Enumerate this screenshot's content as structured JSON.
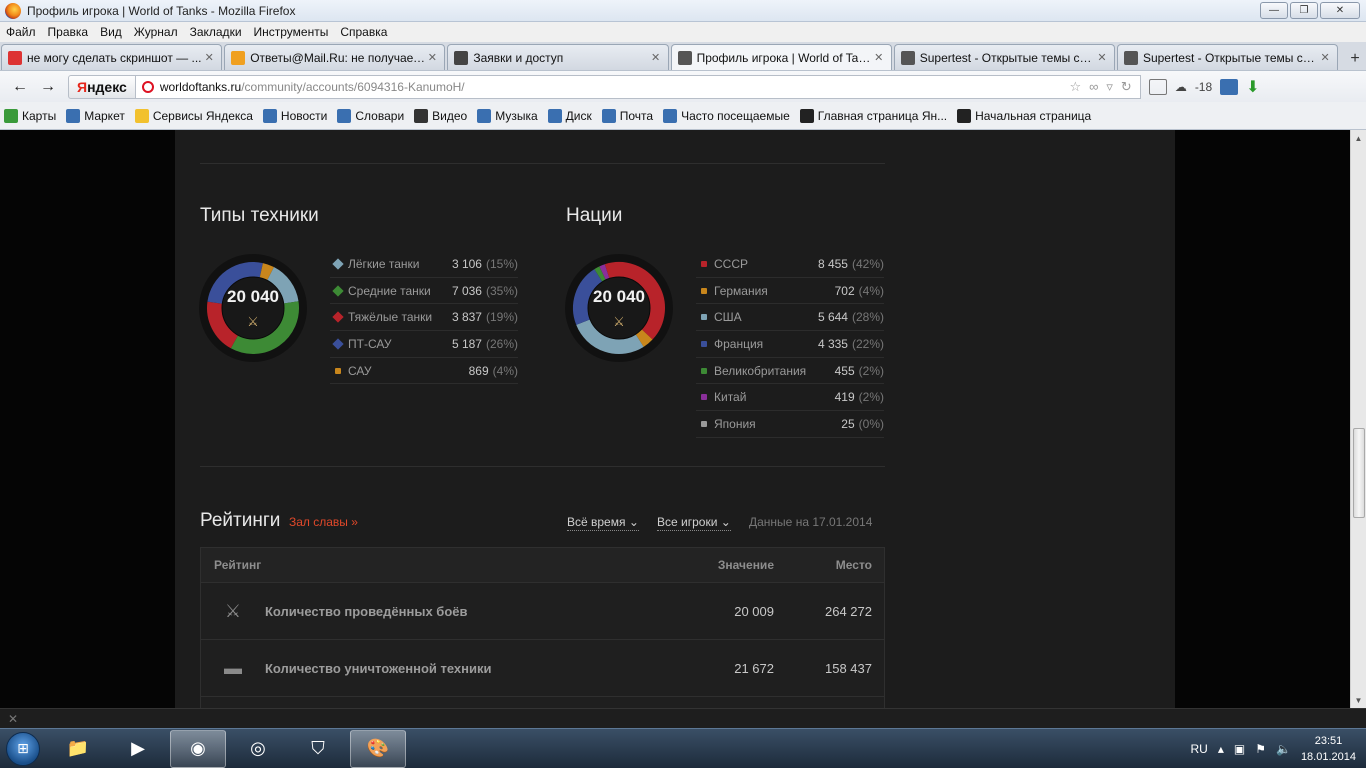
{
  "window": {
    "title": "Профиль игрока | World of Tanks - Mozilla Firefox",
    "controls": [
      "—",
      "❐",
      "✕"
    ]
  },
  "menu": [
    "Файл",
    "Правка",
    "Вид",
    "Журнал",
    "Закладки",
    "Инструменты",
    "Справка"
  ],
  "tabs": [
    {
      "label": "не могу сделать скриншот — ...",
      "icon_color": "#d33"
    },
    {
      "label": "Ответы@Mail.Ru: не получаетс...",
      "icon_color": "#f0a020"
    },
    {
      "label": "Заявки и доступ",
      "icon_color": "#444"
    },
    {
      "label": "Профиль игрока | World of Tan...",
      "icon_color": "#555"
    },
    {
      "label": "Supertest - Открытые темы суп...",
      "icon_color": "#555"
    },
    {
      "label": "Supertest - Открытые темы суп...",
      "icon_color": "#555"
    }
  ],
  "tab_close": "✕",
  "new_tab": "+",
  "nav": {
    "back": "←",
    "forward": "→",
    "search_engine_1": "Я",
    "search_engine_2": "ндекс",
    "url_host": "worldoftanks.ru",
    "url_path": "/community/accounts/6094316-KanumoH/",
    "weather": "-18"
  },
  "bookmarks": [
    {
      "label": "Карты",
      "icon_color": "#3a9a3a"
    },
    {
      "label": "Маркет",
      "icon_color": "#3a6fb0"
    },
    {
      "label": "Сервисы Яндекса",
      "icon_color": "#f2c12e"
    },
    {
      "label": "Новости",
      "icon_color": "#3a6fb0"
    },
    {
      "label": "Словари",
      "icon_color": "#3a6fb0"
    },
    {
      "label": "Видео",
      "icon_color": "#333"
    },
    {
      "label": "Музыка",
      "icon_color": "#3a6fb0"
    },
    {
      "label": "Диск",
      "icon_color": "#3a6fb0"
    },
    {
      "label": "Почта",
      "icon_color": "#3a6fb0"
    },
    {
      "label": "Часто посещаемые",
      "icon_color": "#3a6fb0"
    },
    {
      "label": "Главная страница Ян...",
      "icon_color": "#222"
    },
    {
      "label": "Начальная страница",
      "icon_color": "#222"
    }
  ],
  "vehicle_types": {
    "title": "Типы техники",
    "total": "20 040",
    "items": [
      {
        "name": "Лёгкие танки",
        "value": "3 106",
        "pct": "(15%)",
        "share": 15,
        "color": "#7ea3b5",
        "marker": "diamond"
      },
      {
        "name": "Средние танки",
        "value": "7 036",
        "pct": "(35%)",
        "share": 35,
        "color": "#3d8a35",
        "marker": "diamond"
      },
      {
        "name": "Тяжёлые танки",
        "value": "3 837",
        "pct": "(19%)",
        "share": 19,
        "color": "#b8232a",
        "marker": "diamond"
      },
      {
        "name": "ПТ-САУ",
        "value": "5 187",
        "pct": "(26%)",
        "share": 26,
        "color": "#3a4f9a",
        "marker": "triangle"
      },
      {
        "name": "САУ",
        "value": "869",
        "pct": "(4%)",
        "share": 4,
        "color": "#c8861c",
        "marker": "square"
      }
    ]
  },
  "nations": {
    "title": "Нации",
    "total": "20 040",
    "items": [
      {
        "name": "СССР",
        "value": "8 455",
        "pct": "(42%)",
        "share": 42,
        "color": "#b8232a"
      },
      {
        "name": "Германия",
        "value": "702",
        "pct": "(4%)",
        "share": 4,
        "color": "#c8861c"
      },
      {
        "name": "США",
        "value": "5 644",
        "pct": "(28%)",
        "share": 28,
        "color": "#7ea3b5"
      },
      {
        "name": "Франция",
        "value": "4 335",
        "pct": "(22%)",
        "share": 22,
        "color": "#3a4f9a"
      },
      {
        "name": "Великобритания",
        "value": "455",
        "pct": "(2%)",
        "share": 2,
        "color": "#3d8a35"
      },
      {
        "name": "Китай",
        "value": "419",
        "pct": "(2%)",
        "share": 2,
        "color": "#8a2f9a"
      },
      {
        "name": "Япония",
        "value": "25",
        "pct": "(0%)",
        "share": 0,
        "color": "#9a9a9a"
      }
    ]
  },
  "ratings": {
    "title": "Рейтинги",
    "hall_of_fame": "Зал славы »",
    "period": "Всё время",
    "players": "Все игроки",
    "data_date": "Данные на 17.01.2014",
    "columns": {
      "rating": "Рейтинг",
      "value": "Значение",
      "place": "Место"
    },
    "rows": [
      {
        "name": "Количество проведённых боёв",
        "value": "20 009",
        "place": "264 272",
        "icon": "crossed-swords-icon"
      },
      {
        "name": "Количество уничтоженной техники",
        "value": "21 672",
        "place": "158 437",
        "icon": "tank-icon"
      }
    ]
  },
  "statusbar": "✕",
  "taskbar": {
    "items": [
      {
        "name": "explorer-icon",
        "glyph": "📁"
      },
      {
        "name": "media-player-icon",
        "glyph": "▶"
      },
      {
        "name": "firefox-icon",
        "glyph": "◉"
      },
      {
        "name": "game-client-icon",
        "glyph": "◎"
      },
      {
        "name": "world-of-tanks-icon",
        "glyph": "⛉"
      },
      {
        "name": "paint-icon",
        "glyph": "🎨"
      }
    ],
    "lang": "RU",
    "time": "23:51",
    "date": "18.01.2014"
  }
}
